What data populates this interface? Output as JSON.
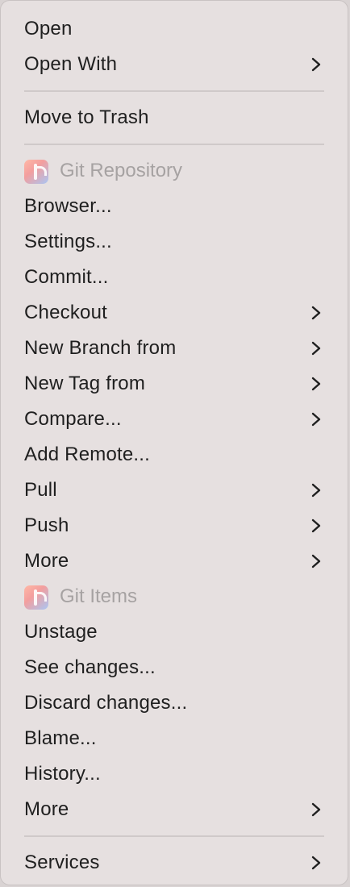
{
  "menu": {
    "top": [
      {
        "label": "Open",
        "submenu": false
      },
      {
        "label": "Open With",
        "submenu": true
      }
    ],
    "trash": {
      "label": "Move to Trash"
    },
    "git_repository": {
      "header": "Git Repository",
      "icon": "git-app-icon",
      "items": [
        {
          "label": "Browser...",
          "submenu": false
        },
        {
          "label": "Settings...",
          "submenu": false
        },
        {
          "label": "Commit...",
          "submenu": false
        },
        {
          "label": "Checkout",
          "submenu": true
        },
        {
          "label": "New Branch from",
          "submenu": true
        },
        {
          "label": "New Tag from",
          "submenu": true
        },
        {
          "label": "Compare...",
          "submenu": true
        },
        {
          "label": "Add Remote...",
          "submenu": false
        },
        {
          "label": "Pull",
          "submenu": true
        },
        {
          "label": "Push",
          "submenu": true
        },
        {
          "label": "More",
          "submenu": true
        }
      ]
    },
    "git_items": {
      "header": "Git Items",
      "icon": "git-app-icon",
      "items": [
        {
          "label": "Unstage",
          "submenu": false
        },
        {
          "label": "See changes...",
          "submenu": false
        },
        {
          "label": "Discard changes...",
          "submenu": false
        },
        {
          "label": "Blame...",
          "submenu": false
        },
        {
          "label": "History...",
          "submenu": false
        },
        {
          "label": "More",
          "submenu": true
        }
      ]
    },
    "services": {
      "label": "Services",
      "submenu": true
    }
  },
  "colors": {
    "background": "#e6e0e0",
    "text": "#1f1f1f",
    "header_text": "#a6a2a2",
    "separator": "#cfc9c9"
  }
}
